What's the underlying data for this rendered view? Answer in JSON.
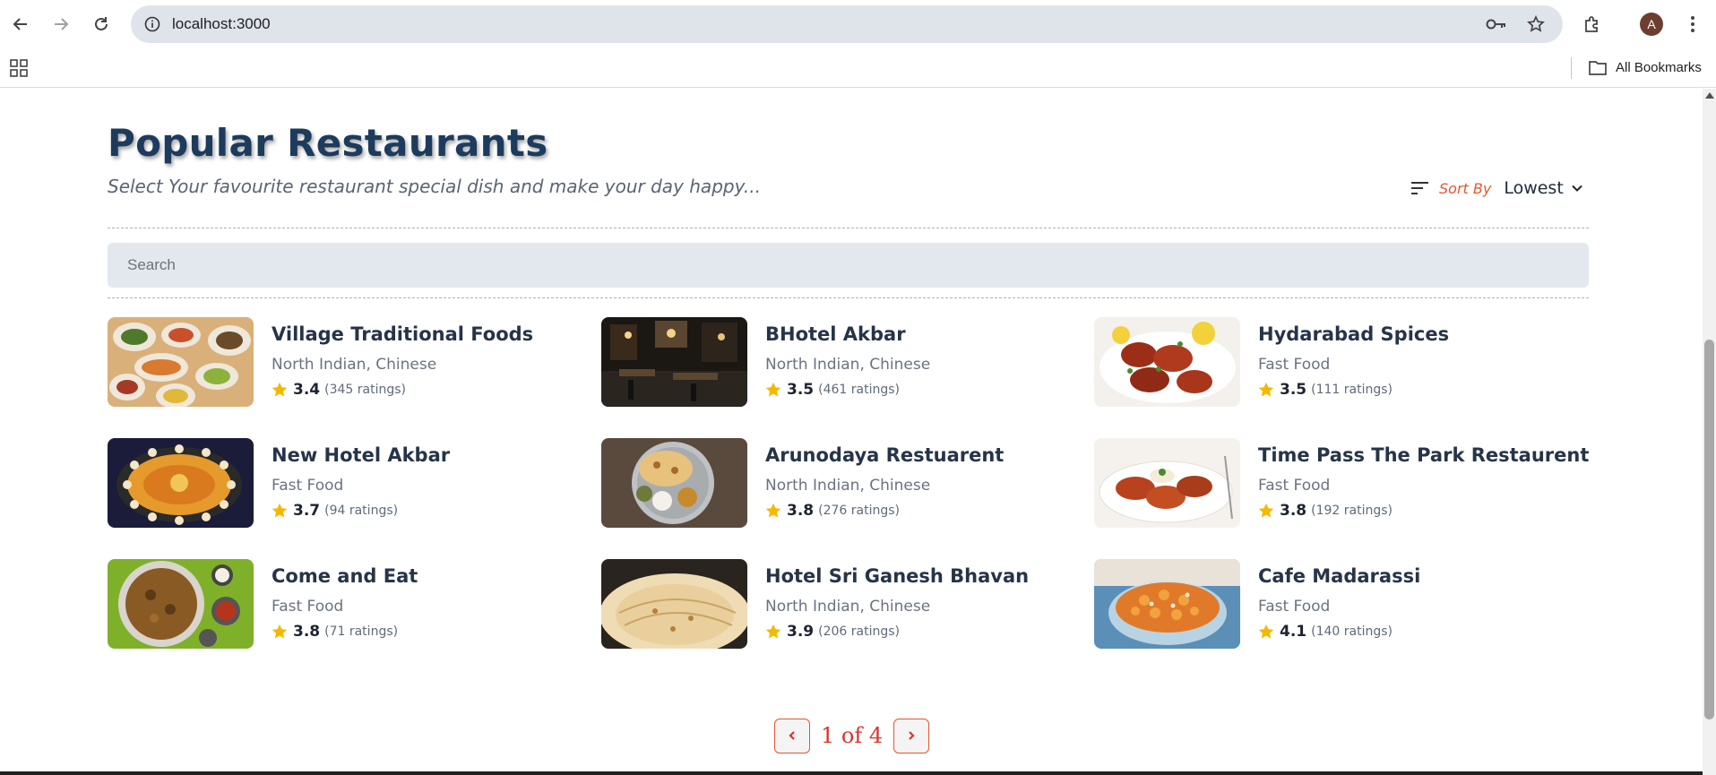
{
  "browser": {
    "url": "localhost:3000",
    "avatar_letter": "A",
    "bookmarks_label": "All Bookmarks"
  },
  "header": {
    "title": "Popular Restaurants",
    "subtitle": "Select Your favourite restaurant special dish and make your day happy...",
    "sort_label": "Sort By",
    "sort_value": "Lowest"
  },
  "search": {
    "placeholder": "Search"
  },
  "restaurants": [
    {
      "name": "Village Traditional Foods",
      "cuisine": "North Indian, Chinese",
      "rating": "3.4",
      "count": "(345 ratings)"
    },
    {
      "name": "BHotel Akbar",
      "cuisine": "North Indian, Chinese",
      "rating": "3.5",
      "count": "(461 ratings)"
    },
    {
      "name": "Hydarabad Spices",
      "cuisine": "Fast Food",
      "rating": "3.5",
      "count": "(111 ratings)"
    },
    {
      "name": "New Hotel Akbar",
      "cuisine": "Fast Food",
      "rating": "3.7",
      "count": "(94 ratings)"
    },
    {
      "name": "Arunodaya Restuarent",
      "cuisine": "North Indian, Chinese",
      "rating": "3.8",
      "count": "(276 ratings)"
    },
    {
      "name": "Time Pass The Park Restaurent",
      "cuisine": "Fast Food",
      "rating": "3.8",
      "count": "(192 ratings)"
    },
    {
      "name": "Come and Eat",
      "cuisine": "Fast Food",
      "rating": "3.8",
      "count": "(71 ratings)"
    },
    {
      "name": "Hotel Sri Ganesh Bhavan",
      "cuisine": "North Indian, Chinese",
      "rating": "3.9",
      "count": "(206 ratings)"
    },
    {
      "name": "Cafe Madarassi",
      "cuisine": "Fast Food",
      "rating": "4.1",
      "count": "(140 ratings)"
    }
  ],
  "pagination": {
    "text": "1 of 4"
  },
  "colors": {
    "accent": "#e4572e",
    "title": "#1d3b5c",
    "star": "#f5b800"
  }
}
